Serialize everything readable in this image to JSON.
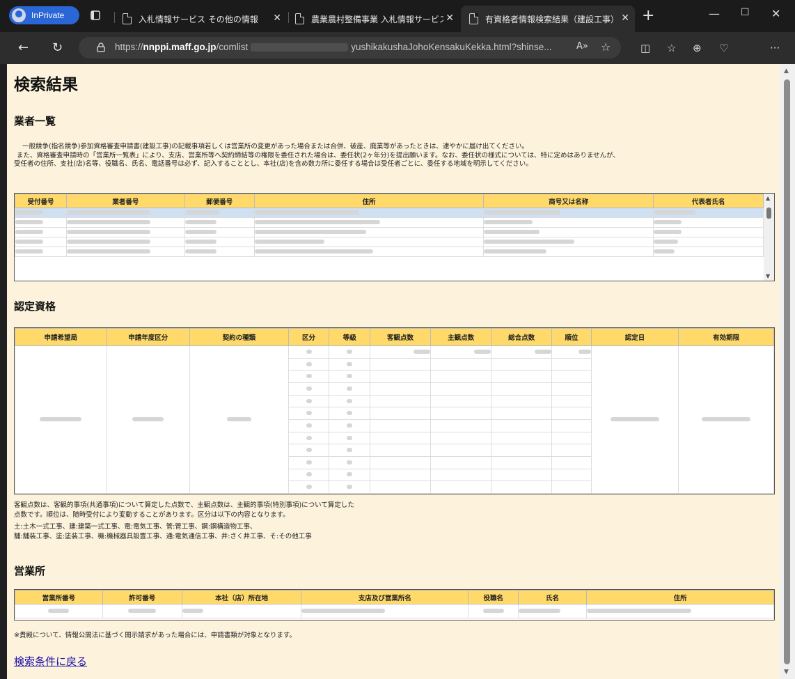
{
  "browser": {
    "inprivate_label": "InPrivate",
    "tabs": [
      {
        "title": "入札情報サービス その他の情報"
      },
      {
        "title": "農業農村整備事業 入札情報サービス"
      },
      {
        "title": "有資格者情報検索結果（建設工事）"
      }
    ],
    "url_prefix": "https://",
    "url_domain": "nnppi.maff.go.jp",
    "url_path1": "/comlist",
    "url_path2": "yushikakushaJohoKensakuKekka.html?shinse..."
  },
  "page": {
    "title": "検索結果",
    "section_vendors": "業者一覧",
    "notice": [
      "一般競争(指名競争)参加資格審査申請書(建設工事)の記載事項若しくは営業所の変更があった場合または合併、破産、廃業等があったときは、速やかに届け出てください。",
      "また、資格審査申請時の「営業所一覧表」により、支店、営業所等へ契約締結等の権限を委任された場合は、委任状(2ヶ年分)を提出願います。なお、委任状の様式については、特に定めはありませんが、",
      "受任者の住所、支社(店)名等、役職名、氏名、電話番号は必ず、記入することとし、本社(店)を含め数カ所に委任する場合は受任者ごとに、委任する地域を明示してください。"
    ],
    "vendor_headers": [
      "受付番号",
      "業者番号",
      "郵便番号",
      "住所",
      "商号又は名称",
      "代表者氏名"
    ],
    "section_qualification": "認定資格",
    "qual_headers": [
      "申請希望局",
      "申請年度区分",
      "契約の種類",
      "区分",
      "等級",
      "客観点数",
      "主観点数",
      "総合点数",
      "順位",
      "認定日",
      "有効期限"
    ],
    "qual_notes": [
      "客観点数は、客観的事項(共通事項)について算定した点数で、主観点数は、主観的事項(特別事項)について算定した",
      "点数です。順位は、随時受付により変動することがあります。区分は以下の内容となります。",
      "土:土木一式工事、建:建築一式工事、電:電気工事、管:管工事、鋼:鋼構造物工事、",
      "舗:舗装工事、塗:塗装工事、機:機械器具設置工事、通:電気通信工事、井:さく井工事、そ:その他工事"
    ],
    "section_office": "営業所",
    "office_headers": [
      "営業所番号",
      "許可番号",
      "本社（店）所在地",
      "支店及び営業所名",
      "役職名",
      "氏名",
      "住所"
    ],
    "disclosure_note": "※貴殿について、情報公開法に基づく開示請求があった場合には、申請書類が対象となります。",
    "back_link": "検索条件に戻る"
  }
}
